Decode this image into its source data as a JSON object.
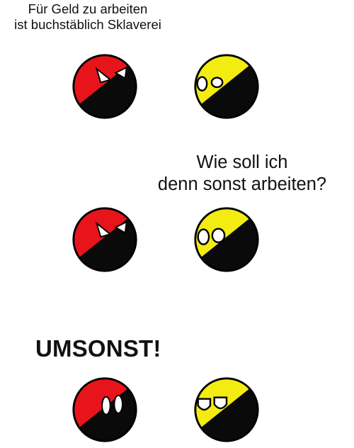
{
  "comic": {
    "panel1": {
      "caption": "Für Geld zu arbeiten ist buchstäblich Sklaverei",
      "caption_lines": [
        "Für Geld zu arbeiten",
        "ist buchstäblich Sklaverei"
      ]
    },
    "panel2": {
      "caption_lines": [
        "Wie soll ich",
        "denn sonst arbeiten?"
      ]
    },
    "panel3": {
      "caption": "UMSONST!"
    }
  },
  "colors": {
    "red_black_flag_red": "#e8141b",
    "black_yellow_flag_yellow": "#f3ec12",
    "ball_black": "#0a0a0a",
    "background": "#ffffff"
  },
  "characters": [
    "anarcho-communism-ball",
    "anarcho-capitalism-ball"
  ]
}
